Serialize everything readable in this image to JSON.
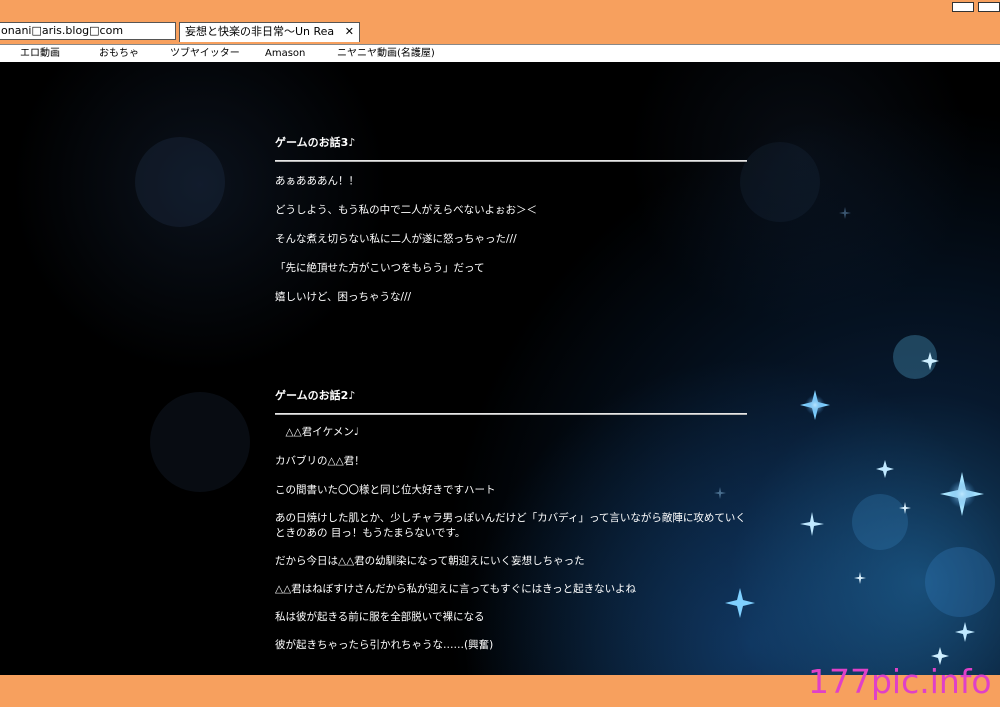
{
  "browser": {
    "address": "onani□aris.blog□com",
    "tab_title": "妄想と快楽の非日常〜Un Real〜",
    "tab_close": "✕",
    "bookmarks": [
      "エロ動画",
      "おもちゃ",
      "ツブヤイッター",
      "Amason",
      "ニヤニヤ動画(名護屋)"
    ]
  },
  "posts": [
    {
      "title": "ゲームのお話3♪",
      "lines": [
        " あぁあああん！！",
        "どうしよう、もう私の中で二人がえらべないよぉお＞＜",
        "そんな煮え切らない私に二人が遂に怒っちゃった///",
        "「先に絶頂せた方がこいつをもらう」だって",
        "嬉しいけど、困っちゃうな///"
      ]
    },
    {
      "title": "ゲームのお話2♪",
      "lines": [
        "　△△君イケメン♩",
        "カバブリの△△君！",
        "この間書いた〇〇様と同じ位大好きですハート",
        "あの日焼けした肌とか、少しチャラ男っぽいんだけど「カバディ」って言いながら敵陣に攻めていくときのあの 目っ！もうたまらないです。",
        "だから今日は△△君の幼馴染になって朝迎えにいく妄想しちゃった",
        "△△君はねぼすけさんだから私が迎えに言ってもすぐにはきっと起きないよね",
        "私は彼が起きる前に服を全部脱いで裸になる",
        "彼が起きちゃったら引かれちゃうな……(興奮)"
      ]
    }
  ],
  "watermark": "177pic.info",
  "colors": {
    "frame": "#f7a05e",
    "background": "#000000",
    "text": "#ffffff",
    "watermark": "#e040c8"
  }
}
